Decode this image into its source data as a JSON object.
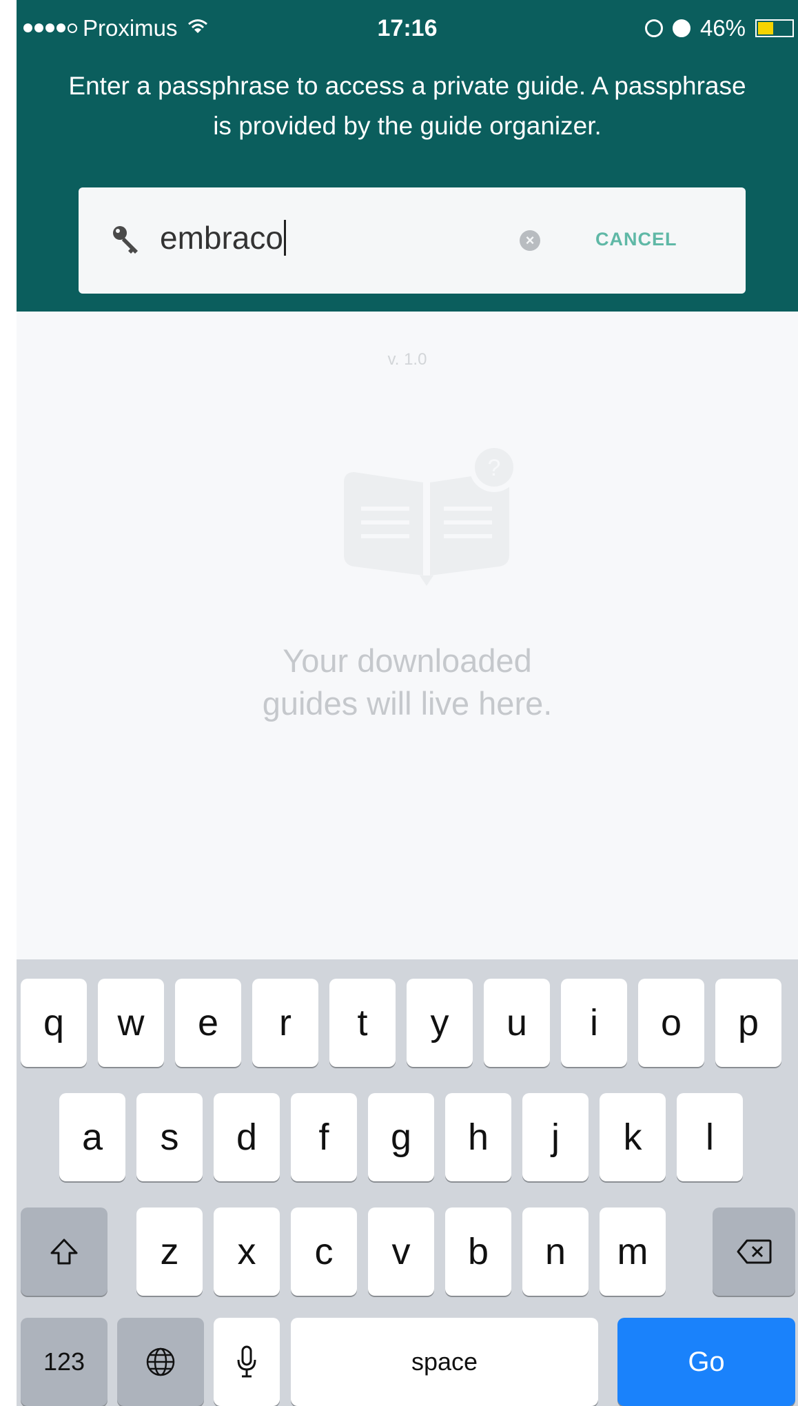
{
  "status_bar": {
    "carrier": "Proximus",
    "time": "17:16",
    "battery": "46%",
    "battery_level": 0.46
  },
  "header": {
    "description": "Enter a passphrase to access a private guide. A passphrase is provided by the guide organizer.",
    "search": {
      "value": "embraco",
      "cancel_label": "CANCEL"
    }
  },
  "main": {
    "version": "v. 1.0",
    "empty_message_line1": "Your downloaded",
    "empty_message_line2": "guides will live here."
  },
  "keyboard": {
    "row1": [
      "q",
      "w",
      "e",
      "r",
      "t",
      "y",
      "u",
      "i",
      "o",
      "p"
    ],
    "row2": [
      "a",
      "s",
      "d",
      "f",
      "g",
      "h",
      "j",
      "k",
      "l"
    ],
    "row3": [
      "z",
      "x",
      "c",
      "v",
      "b",
      "n",
      "m"
    ],
    "numbers_label": "123",
    "space_label": "space",
    "go_label": "Go"
  },
  "colors": {
    "header_bg": "#0b5e5d",
    "accent": "#5fb8a6",
    "go_key": "#1a82fb",
    "battery": "#f5d400"
  }
}
